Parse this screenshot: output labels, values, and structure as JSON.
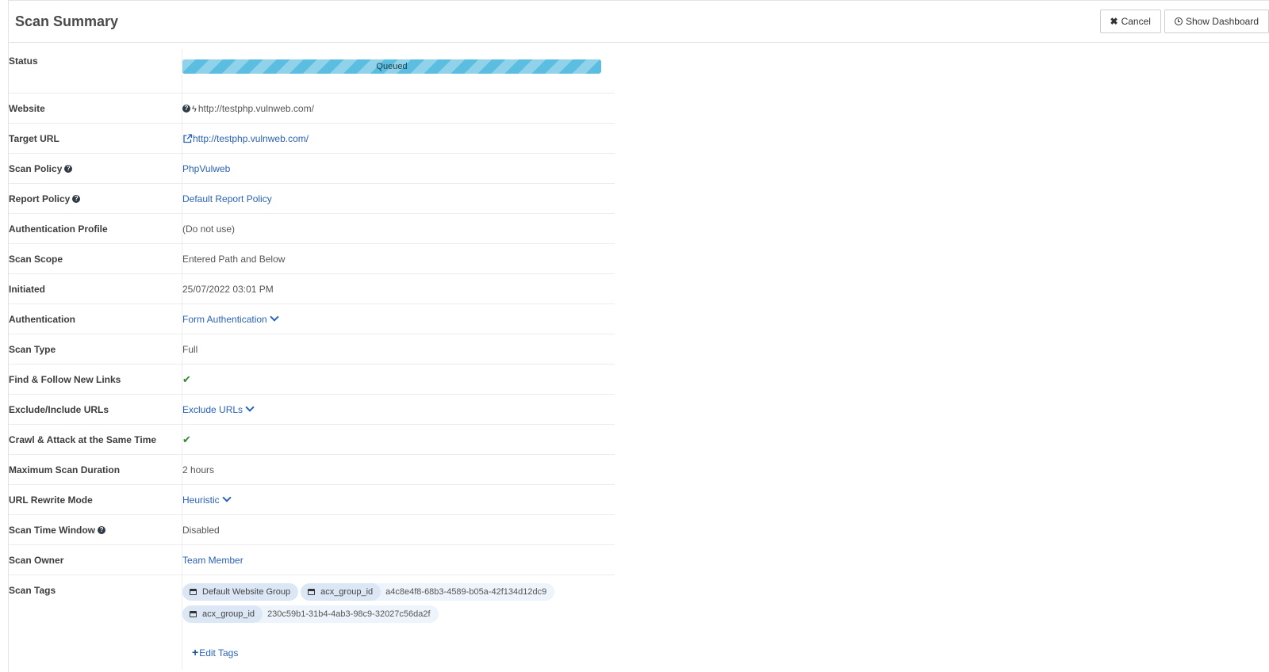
{
  "header": {
    "title": "Scan Summary",
    "cancel_label": "Cancel",
    "dashboard_label": "Show Dashboard"
  },
  "status": {
    "label": "Status",
    "value": "Queued"
  },
  "rows": {
    "website": {
      "label": "Website",
      "value": "http://testphp.vulnweb.com/"
    },
    "target_url": {
      "label": "Target URL",
      "value": "http://testphp.vulnweb.com/"
    },
    "scan_policy": {
      "label": "Scan Policy",
      "value": "PhpVulweb"
    },
    "report_policy": {
      "label": "Report Policy",
      "value": "Default Report Policy"
    },
    "auth_profile": {
      "label": "Authentication Profile",
      "value": "(Do not use)"
    },
    "scan_scope": {
      "label": "Scan Scope",
      "value": "Entered Path and Below"
    },
    "initiated": {
      "label": "Initiated",
      "value": "25/07/2022 03:01 PM"
    },
    "authentication": {
      "label": "Authentication",
      "value": "Form Authentication"
    },
    "scan_type": {
      "label": "Scan Type",
      "value": "Full"
    },
    "find_follow": {
      "label": "Find & Follow New Links",
      "value": "✔"
    },
    "exclude_include": {
      "label": "Exclude/Include URLs",
      "value": "Exclude URLs"
    },
    "crawl_attack": {
      "label": "Crawl & Attack at the Same Time",
      "value": "✔"
    },
    "max_duration": {
      "label": "Maximum Scan Duration",
      "value": "2 hours"
    },
    "url_rewrite": {
      "label": "URL Rewrite Mode",
      "value": "Heuristic"
    },
    "time_window": {
      "label": "Scan Time Window",
      "value": "Disabled"
    },
    "scan_owner": {
      "label": "Scan Owner",
      "value": "Team Member"
    },
    "scan_tags": {
      "label": "Scan Tags"
    }
  },
  "tags": [
    {
      "key": "Default Website Group",
      "value": ""
    },
    {
      "key": "acx_group_id",
      "value": "a4c8e4f8-68b3-4589-b05a-42f134d12dc9"
    },
    {
      "key": "acx_group_id",
      "value": "230c59b1-31b4-4ab3-98c9-32027c56da2f"
    }
  ],
  "edit_tags_label": "Edit Tags",
  "colors": {
    "link": "#2a62b8",
    "progress": "#5bbde0",
    "check": "#2a8a2a"
  },
  "icons": {
    "cancel": "x-icon",
    "dashboard": "clock-icon",
    "help": "question-circle-icon",
    "website": "bolt-icon",
    "target": "external-link-icon",
    "check": "check-icon",
    "tag": "window-icon",
    "edit": "plus-icon"
  }
}
